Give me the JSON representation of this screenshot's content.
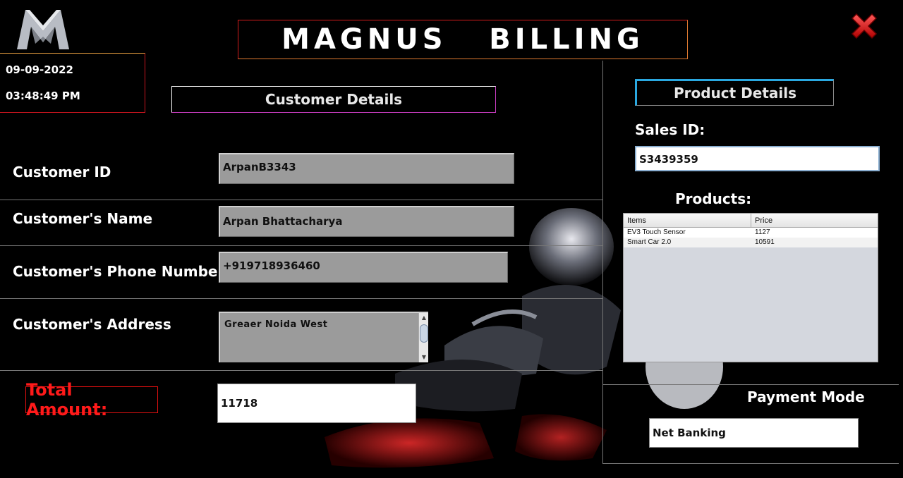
{
  "app": {
    "title": "MAGNUS   BILLING",
    "logo_icon": "magnus-m-logo",
    "close_icon": "close-x-icon"
  },
  "datetime": {
    "date": "09-09-2022",
    "time": "03:48:49 PM"
  },
  "customer": {
    "heading": "Customer Details",
    "id_label": "Customer ID",
    "id_value": "ArpanB3343",
    "name_label": "Customer's Name",
    "name_value": "Arpan Bhattacharya",
    "phone_label": "Customer's Phone Number",
    "phone_value": "+919718936460",
    "address_label": "Customer's Address",
    "address_value": "Greaer Noida West"
  },
  "total": {
    "label": "Total Amount:",
    "value": "11718"
  },
  "product": {
    "heading": "Product Details",
    "sales_id_label": "Sales ID:",
    "sales_id_value": "S3439359",
    "products_label": "Products:",
    "columns": [
      "Items",
      "Price"
    ],
    "rows": [
      [
        "EV3 Touch  Sensor",
        "1127"
      ],
      [
        "Smart Car 2.0",
        "10591"
      ]
    ]
  },
  "payment": {
    "label": "Payment Mode",
    "value": "Net Banking"
  },
  "colors": {
    "accent_red": "#e01010",
    "accent_orange": "#e07a30",
    "accent_blue": "#2aa8e0",
    "field_gray": "#9b9b9b"
  }
}
